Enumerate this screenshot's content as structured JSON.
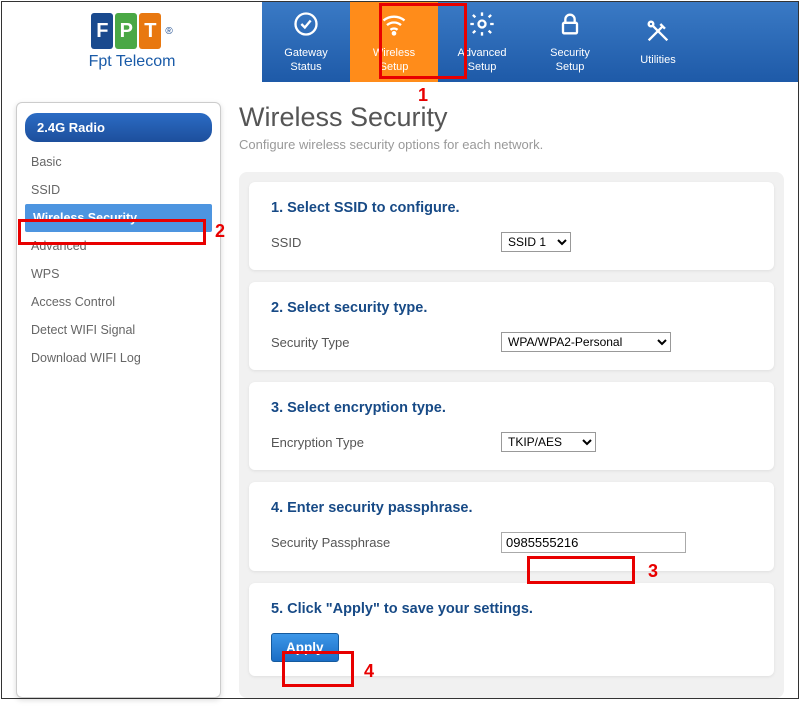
{
  "brand": {
    "name": "Fpt Telecom",
    "letters": [
      "F",
      "P",
      "T"
    ]
  },
  "nav": {
    "items": [
      {
        "label_line1": "Gateway",
        "label_line2": "Status"
      },
      {
        "label_line1": "Wireless",
        "label_line2": "Setup"
      },
      {
        "label_line1": "Advanced",
        "label_line2": "Setup"
      },
      {
        "label_line1": "Security",
        "label_line2": "Setup"
      },
      {
        "label_line1": "Utilities",
        "label_line2": ""
      }
    ]
  },
  "sidebar": {
    "header": "2.4G Radio",
    "items": [
      {
        "label": "Basic"
      },
      {
        "label": "SSID"
      },
      {
        "label": "Wireless Security"
      },
      {
        "label": "Advanced"
      },
      {
        "label": "WPS"
      },
      {
        "label": "Access Control"
      },
      {
        "label": "Detect WIFI Signal"
      },
      {
        "label": "Download WIFI Log"
      }
    ]
  },
  "page": {
    "title": "Wireless Security",
    "subtitle": "Configure wireless security options for each network."
  },
  "sections": {
    "s1": {
      "title": "1. Select SSID to configure.",
      "label": "SSID",
      "value": "SSID 1"
    },
    "s2": {
      "title": "2. Select security type.",
      "label": "Security Type",
      "value": "WPA/WPA2-Personal"
    },
    "s3": {
      "title": "3. Select encryption type.",
      "label": "Encryption Type",
      "value": "TKIP/AES"
    },
    "s4": {
      "title": "4. Enter security passphrase.",
      "label": "Security Passphrase",
      "value": "0985555216"
    },
    "s5": {
      "title": "5. Click \"Apply\" to save your settings.",
      "button": "Apply"
    }
  },
  "annotations": {
    "n1": "1",
    "n2": "2",
    "n3": "3",
    "n4": "4"
  }
}
